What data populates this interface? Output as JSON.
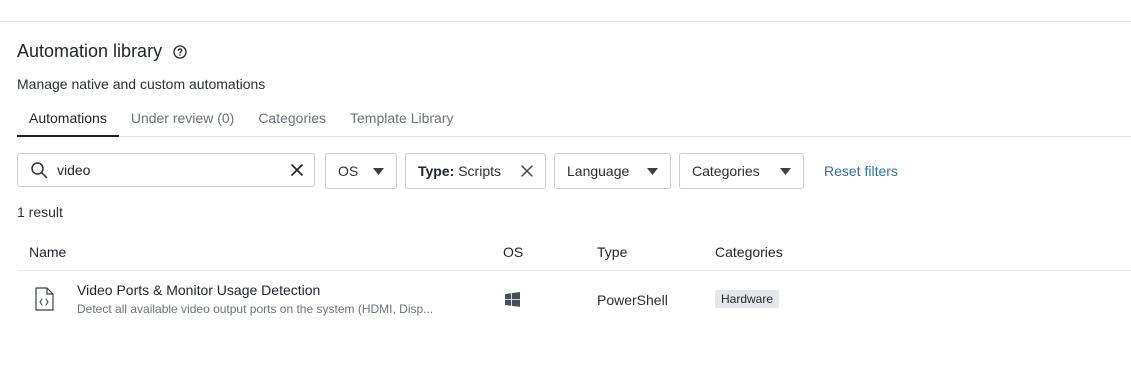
{
  "page": {
    "title": "Automation library",
    "subtitle": "Manage native and custom automations"
  },
  "tabs": [
    {
      "label": "Automations",
      "active": true
    },
    {
      "label": "Under review (0)",
      "active": false
    },
    {
      "label": "Categories",
      "active": false
    },
    {
      "label": "Template Library",
      "active": false
    }
  ],
  "filters": {
    "search_value": "video",
    "os_label": "OS",
    "type_key": "Type:",
    "type_value": "Scripts",
    "language_label": "Language",
    "categories_label": "Categories",
    "reset_label": "Reset filters"
  },
  "results": {
    "count_text": "1 result"
  },
  "table": {
    "columns": [
      "Name",
      "OS",
      "Type",
      "Categories"
    ],
    "rows": [
      {
        "name": "Video Ports & Monitor Usage Detection",
        "description": "Detect all available video output ports on the system (HDMI, Disp...",
        "os_icon": "windows-icon",
        "type": "PowerShell",
        "category": "Hardware"
      }
    ]
  },
  "colors": {
    "link": "#2f6fa7",
    "badge_bg": "#e4e6e9",
    "border": "#c9ccd0"
  }
}
